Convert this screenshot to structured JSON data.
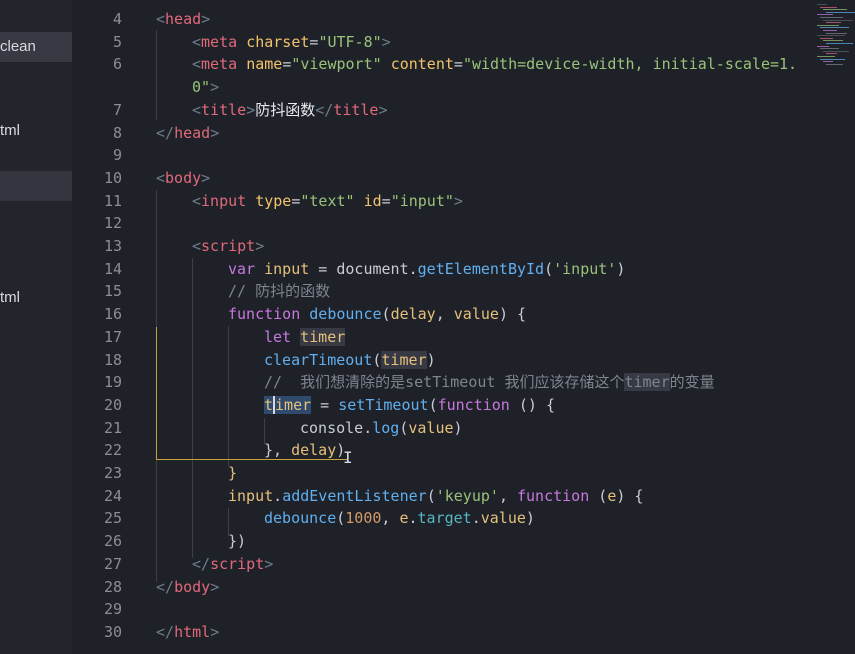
{
  "sidebar": {
    "items": [
      {
        "label": "clean",
        "state": "active"
      },
      {
        "label": "tml",
        "state": "normal"
      },
      {
        "label": "",
        "state": "highlight"
      },
      {
        "label": "tml",
        "state": "normal"
      }
    ]
  },
  "editor": {
    "lines": [
      {
        "n": "4",
        "tokens": [
          [
            "t-br",
            "<"
          ],
          [
            "t-tag",
            "head"
          ],
          [
            "t-br",
            ">"
          ]
        ]
      },
      {
        "n": "5",
        "tokens": [
          [
            "t-br",
            "<"
          ],
          [
            "t-tag",
            "meta"
          ],
          [
            "t-plain",
            " "
          ],
          [
            "t-attr",
            "charset"
          ],
          [
            "t-plain",
            "="
          ],
          [
            "t-str",
            "\"UTF-8\""
          ],
          [
            "t-br",
            ">"
          ]
        ]
      },
      {
        "n": "6",
        "tokens": [
          [
            "t-br",
            "<"
          ],
          [
            "t-tag",
            "meta"
          ],
          [
            "t-plain",
            " "
          ],
          [
            "t-attr",
            "name"
          ],
          [
            "t-plain",
            "="
          ],
          [
            "t-str",
            "\"viewport\""
          ],
          [
            "t-plain",
            " "
          ],
          [
            "t-attr",
            "content"
          ],
          [
            "t-plain",
            "="
          ],
          [
            "t-str",
            "\"width=device-width, initial-scale=1."
          ]
        ]
      },
      {
        "n": "",
        "tokens": [
          [
            "t-str",
            "0\""
          ],
          [
            "t-br",
            ">"
          ]
        ]
      },
      {
        "n": "7",
        "tokens": [
          [
            "t-br",
            "<"
          ],
          [
            "t-tag",
            "title"
          ],
          [
            "t-br",
            ">"
          ],
          [
            "t-cn",
            "防抖函数"
          ],
          [
            "t-br",
            "</"
          ],
          [
            "t-tag",
            "title"
          ],
          [
            "t-br",
            ">"
          ]
        ]
      },
      {
        "n": "8",
        "tokens": [
          [
            "t-br",
            "</"
          ],
          [
            "t-tag",
            "head"
          ],
          [
            "t-br",
            ">"
          ]
        ]
      },
      {
        "n": "9",
        "tokens": []
      },
      {
        "n": "10",
        "tokens": [
          [
            "t-br",
            "<"
          ],
          [
            "t-tag",
            "body"
          ],
          [
            "t-br",
            ">"
          ]
        ]
      },
      {
        "n": "11",
        "tokens": [
          [
            "t-br",
            "<"
          ],
          [
            "t-tag",
            "input"
          ],
          [
            "t-plain",
            " "
          ],
          [
            "t-attr",
            "type"
          ],
          [
            "t-plain",
            "="
          ],
          [
            "t-str",
            "\"text\""
          ],
          [
            "t-plain",
            " "
          ],
          [
            "t-attr",
            "id"
          ],
          [
            "t-plain",
            "="
          ],
          [
            "t-str",
            "\"input\""
          ],
          [
            "t-br",
            ">"
          ]
        ]
      },
      {
        "n": "12",
        "tokens": []
      },
      {
        "n": "13",
        "tokens": [
          [
            "t-br",
            "<"
          ],
          [
            "t-tag",
            "script"
          ],
          [
            "t-br",
            ">"
          ]
        ]
      },
      {
        "n": "14",
        "tokens": [
          [
            "t-kw",
            "var"
          ],
          [
            "t-plain",
            " "
          ],
          [
            "t-var",
            "input"
          ],
          [
            "t-plain",
            " = "
          ],
          [
            "t-plain",
            "document."
          ],
          [
            "t-fn",
            "getElementById"
          ],
          [
            "t-plain",
            "("
          ],
          [
            "t-str",
            "'input'"
          ],
          [
            "t-plain",
            ")"
          ]
        ]
      },
      {
        "n": "15",
        "tokens": [
          [
            "t-com",
            "// 防抖的函数"
          ]
        ]
      },
      {
        "n": "16",
        "tokens": [
          [
            "t-kw",
            "function"
          ],
          [
            "t-plain",
            " "
          ],
          [
            "t-fn",
            "debounce"
          ],
          [
            "t-plain",
            "("
          ],
          [
            "t-var",
            "delay"
          ],
          [
            "t-plain",
            ", "
          ],
          [
            "t-var",
            "value"
          ],
          [
            "t-plain",
            ") {"
          ]
        ]
      },
      {
        "n": "17",
        "tokens": [
          [
            "t-kw",
            "let"
          ],
          [
            "t-plain",
            " "
          ],
          [
            "hl2 t-var",
            "timer"
          ]
        ]
      },
      {
        "n": "18",
        "tokens": [
          [
            "t-fn",
            "clearTimeout"
          ],
          [
            "t-plain",
            "("
          ],
          [
            "hl2 t-var",
            "timer"
          ],
          [
            "t-plain",
            ")"
          ]
        ]
      },
      {
        "n": "19",
        "tokens": [
          [
            "t-com",
            "//  我们想清除的是setTimeout 我们应该存储这个"
          ],
          [
            "hl2 t-com",
            "timer"
          ],
          [
            "t-com",
            "的变量"
          ]
        ]
      },
      {
        "n": "20",
        "tokens": [
          [
            "hl t-var",
            "t"
          ],
          [
            "caret",
            ""
          ],
          [
            "hl t-var",
            "imer"
          ],
          [
            "t-plain",
            " = "
          ],
          [
            "t-fn",
            "setTimeout"
          ],
          [
            "t-plain",
            "("
          ],
          [
            "t-kw",
            "function"
          ],
          [
            "t-plain",
            " () {"
          ]
        ]
      },
      {
        "n": "21",
        "tokens": [
          [
            "t-plain",
            "console."
          ],
          [
            "t-fn",
            "log"
          ],
          [
            "t-plain",
            "("
          ],
          [
            "t-var",
            "value"
          ],
          [
            "t-plain",
            ")"
          ]
        ]
      },
      {
        "n": "22",
        "tokens": [
          [
            "t-plain",
            "}, "
          ],
          [
            "t-var",
            "delay"
          ],
          [
            "t-plain",
            ")"
          ]
        ]
      },
      {
        "n": "23",
        "tokens": [
          [
            "t-var",
            "}"
          ]
        ]
      },
      {
        "n": "24",
        "tokens": [
          [
            "t-var",
            "input"
          ],
          [
            "t-plain",
            "."
          ],
          [
            "t-fn",
            "addEventListener"
          ],
          [
            "t-plain",
            "("
          ],
          [
            "t-str",
            "'keyup'"
          ],
          [
            "t-plain",
            ", "
          ],
          [
            "t-kw",
            "function"
          ],
          [
            "t-plain",
            " ("
          ],
          [
            "t-var",
            "e"
          ],
          [
            "t-plain",
            ") {"
          ]
        ]
      },
      {
        "n": "25",
        "tokens": [
          [
            "t-fn",
            "debounce"
          ],
          [
            "t-plain",
            "("
          ],
          [
            "t-num",
            "1000"
          ],
          [
            "t-plain",
            ", "
          ],
          [
            "t-var",
            "e"
          ],
          [
            "t-plain",
            "."
          ],
          [
            "t-prop",
            "target"
          ],
          [
            "t-plain",
            "."
          ],
          [
            "t-var",
            "value"
          ],
          [
            "t-plain",
            ")"
          ]
        ]
      },
      {
        "n": "26",
        "tokens": [
          [
            "t-plain",
            "})"
          ]
        ]
      },
      {
        "n": "27",
        "tokens": [
          [
            "t-br",
            "</"
          ],
          [
            "t-tag",
            "script"
          ],
          [
            "t-br",
            ">"
          ]
        ]
      },
      {
        "n": "28",
        "tokens": [
          [
            "t-br",
            "</"
          ],
          [
            "t-tag",
            "body"
          ],
          [
            "t-br",
            ">"
          ]
        ]
      },
      {
        "n": "29",
        "tokens": []
      },
      {
        "n": "30",
        "tokens": [
          [
            "t-br",
            "</"
          ],
          [
            "t-tag",
            "html"
          ],
          [
            "t-br",
            ">"
          ]
        ]
      }
    ]
  },
  "colors": {
    "background": "#1f2129",
    "tag": "#e0697a",
    "attribute": "#f2c36a",
    "string": "#98c379",
    "keyword": "#c678dd",
    "function": "#61afef",
    "variable": "#e5c07b",
    "comment": "#7f848e"
  }
}
